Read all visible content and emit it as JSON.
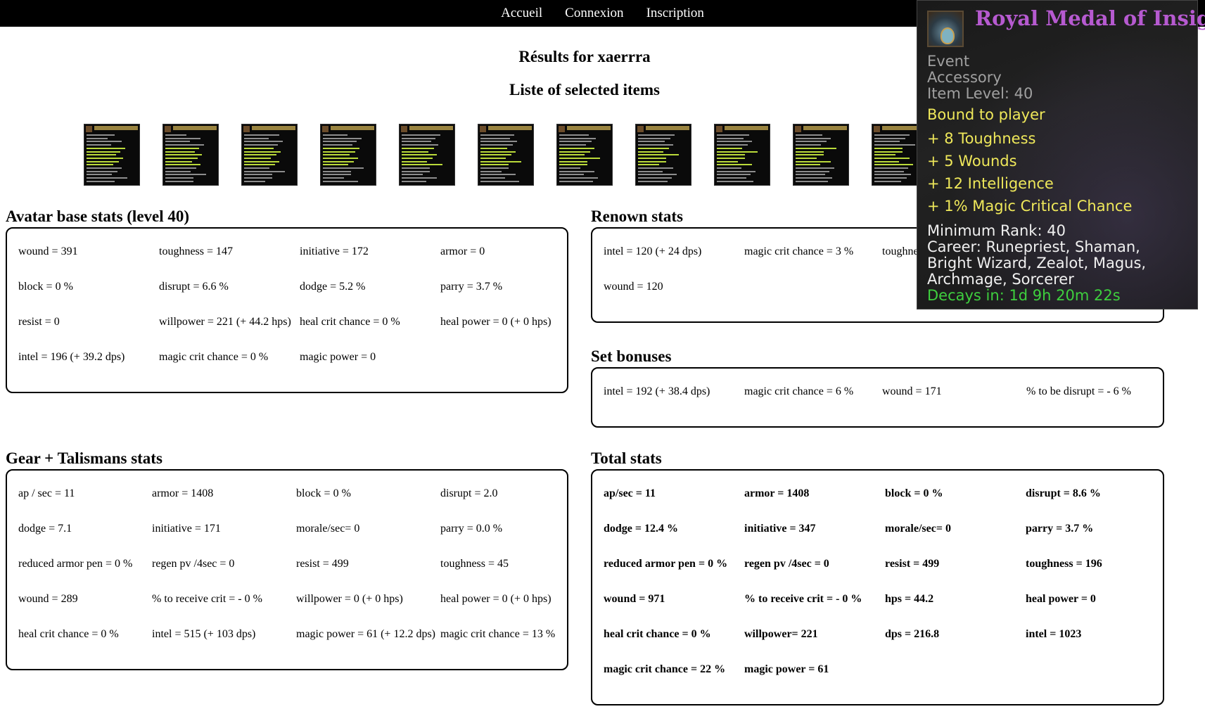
{
  "nav": {
    "items": [
      "Accueil",
      "Connexion",
      "Inscription"
    ]
  },
  "page": {
    "title": "Résults for xaerrra",
    "items_title": "Liste of selected items",
    "item_count": 11
  },
  "avatar": {
    "heading": "Avatar base stats (level 40)",
    "stats": [
      "wound = 391",
      "toughness = 147",
      "initiative = 172",
      "armor = 0",
      "block = 0 %",
      "disrupt = 6.6 %",
      "dodge = 5.2 %",
      "parry = 3.7 %",
      "resist = 0",
      "willpower = 221 (+ 44.2 hps)",
      "heal crit chance = 0 %",
      "heal power = 0 (+ 0 hps)",
      "intel = 196 (+ 39.2 dps)",
      "magic crit chance = 0 %",
      "magic power = 0"
    ]
  },
  "renown": {
    "heading": "Renown stats",
    "stats": [
      "intel = 120 (+ 24 dps)",
      "magic crit chance = 3 %",
      "toughne",
      "wound = 120"
    ]
  },
  "set_bonuses": {
    "heading": "Set bonuses",
    "stats": [
      "intel = 192 (+ 38.4 dps)",
      "magic crit chance = 6 %",
      "wound = 171",
      "% to be disrupt = - 6 %"
    ]
  },
  "gear": {
    "heading": "Gear + Talismans stats",
    "stats": [
      "ap / sec = 11",
      "armor = 1408",
      "block = 0 %",
      "disrupt = 2.0",
      "dodge = 7.1",
      "initiative = 171",
      "morale/sec= 0",
      "parry = 0.0 %",
      "reduced armor pen = 0 %",
      "regen pv /4sec = 0",
      "resist = 499",
      "toughness = 45",
      "wound = 289",
      "% to receive crit = - 0 %",
      "willpower = 0 (+ 0 hps)",
      "heal power = 0 (+ 0 hps)",
      "heal crit chance = 0 %",
      "intel = 515 (+ 103 dps)",
      "magic power = 61 (+ 12.2 dps)",
      "magic crit chance = 13 %"
    ]
  },
  "total": {
    "heading": "Total stats",
    "stats": [
      "ap/sec = 11",
      "armor = 1408",
      "block = 0 %",
      "disrupt = 8.6 %",
      "dodge = 12.4 %",
      "initiative = 347",
      "morale/sec= 0",
      "parry = 3.7 %",
      "reduced armor pen = 0 %",
      "regen pv /4sec = 0",
      "resist = 499",
      "toughness = 196",
      "wound = 971",
      "% to receive crit = - 0 %",
      "hps = 44.2",
      "heal power = 0",
      "heal crit chance = 0 %",
      "willpower= 221",
      "dps = 216.8",
      "intel = 1023",
      "magic crit chance = 22 %",
      "magic power = 61"
    ]
  },
  "tooltip": {
    "name": "Royal Medal of Insight",
    "name_color": "#b65ad0",
    "type_lines": [
      "Event",
      "Accessory",
      "Item Level: 40"
    ],
    "bound": "Bound to player",
    "bonuses": [
      "+ 8 Toughness",
      "+ 5 Wounds",
      "+ 12 Intelligence",
      "+ 1% Magic Critical Chance"
    ],
    "requirements": [
      "Minimum Rank: 40",
      "Career: Runepriest, Shaman,",
      "Bright Wizard, Zealot, Magus,",
      "Archmage, Sorcerer"
    ],
    "decay": "Decays in:  1d 9h 20m 22s",
    "icon": "medal-icon"
  }
}
